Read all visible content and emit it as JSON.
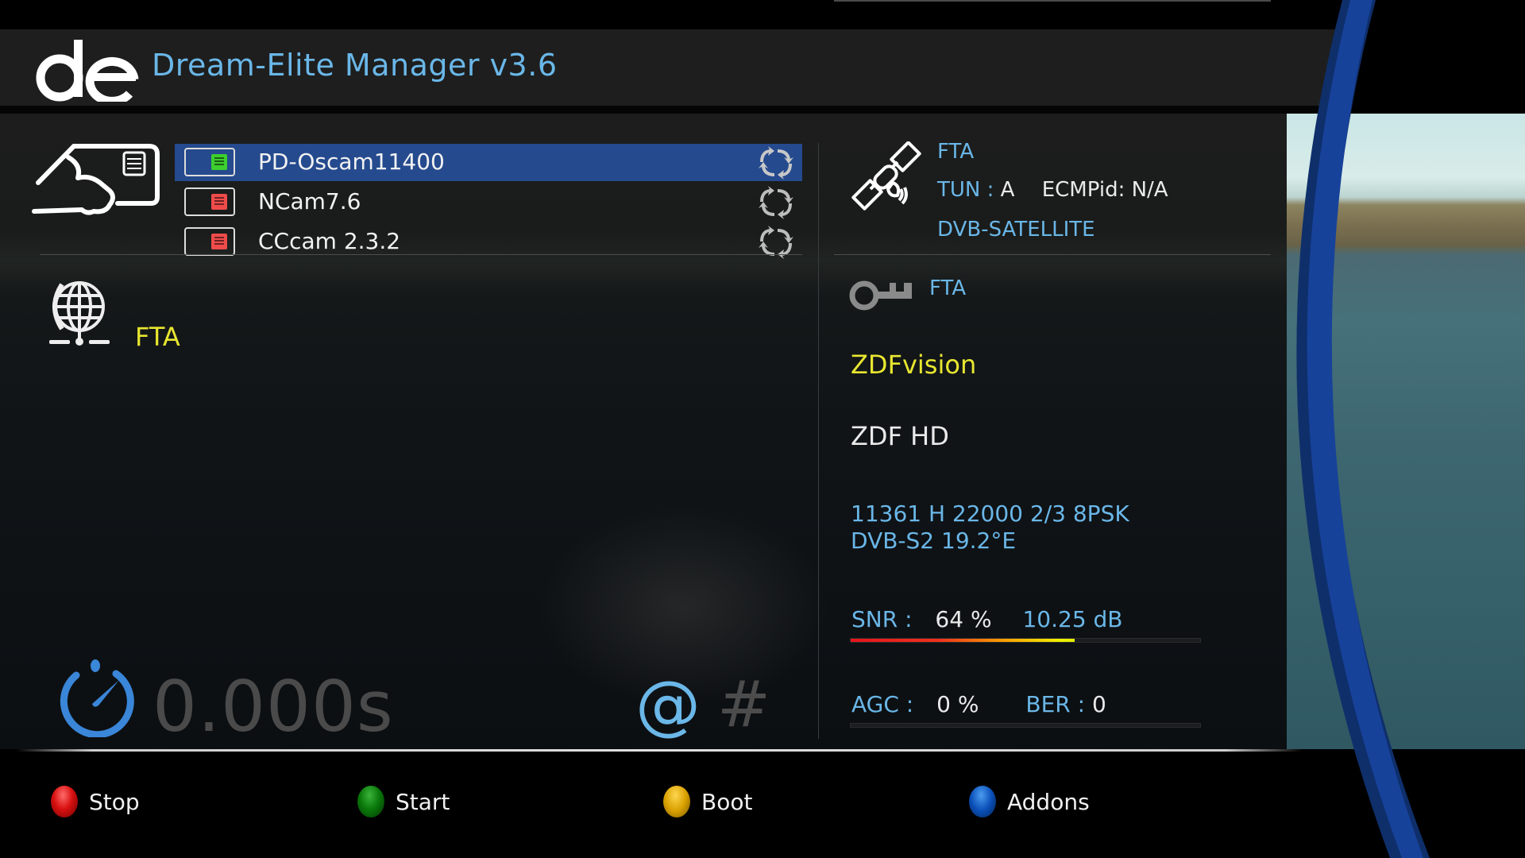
{
  "header": {
    "logo": "de",
    "title": "Dream-Elite Manager v3.6"
  },
  "cams": {
    "items": [
      {
        "label": "PD-Oscam11400",
        "selected": true,
        "status": "running"
      },
      {
        "label": "NCam7.6",
        "selected": false,
        "status": "stopped"
      },
      {
        "label": "CCcam 2.3.2",
        "selected": false,
        "status": "stopped"
      }
    ]
  },
  "left_panel": {
    "cam_status": "FTA",
    "ecm_time": "0.000s",
    "at_symbol": "@",
    "hash_symbol": "#"
  },
  "right_panel": {
    "encryption": "FTA",
    "tuner_label": "TUN :",
    "tuner_value": "A",
    "ecmpid_label": "ECMPid:",
    "ecmpid_value": "N/A",
    "delivery": "DVB-SATELLITE",
    "caid": "FTA",
    "provider": "ZDFvision",
    "channel": "ZDF HD",
    "transponder_line1": "11361 H 22000 2/3  8PSK",
    "transponder_line2": "DVB-S2  19.2°E",
    "snr_label": "SNR :",
    "snr_percent": "64 %",
    "snr_percent_value": 64,
    "snr_db": "10.25 dB",
    "agc_label": "AGC :",
    "agc_percent": "0 %",
    "agc_percent_value": 0,
    "ber_label": "BER :",
    "ber_value": "0"
  },
  "buttons": {
    "red": "Stop",
    "green": "Start",
    "yellow": "Boot",
    "blue": "Addons"
  },
  "colors": {
    "accent_blue": "#6ab7e8",
    "highlight_yellow": "#e8e630",
    "selection": "#254a8e"
  }
}
